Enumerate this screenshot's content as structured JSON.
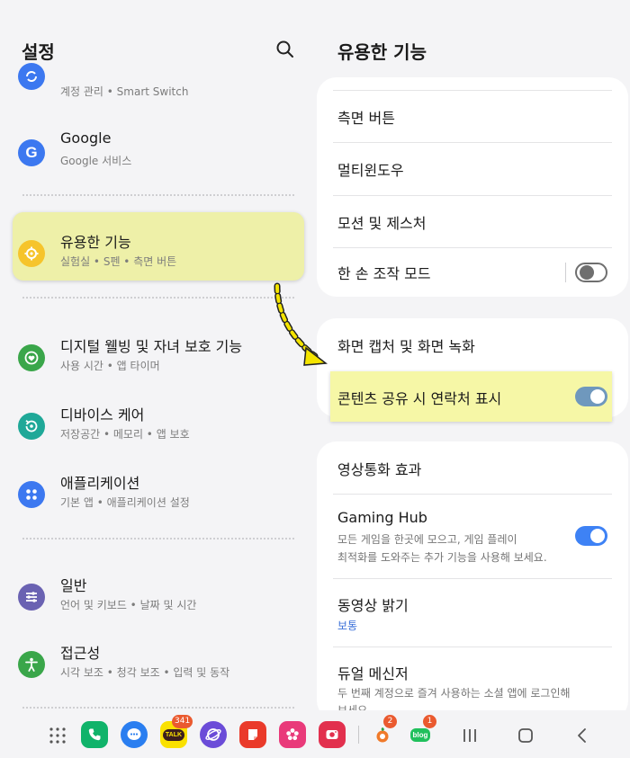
{
  "left": {
    "title": "설정",
    "rows": [
      {
        "title": "",
        "subtitle": "계정 관리 • Smart Switch",
        "icon": "sync-icon",
        "color": "#3c78f0"
      },
      {
        "title": "Google",
        "subtitle": "Google 서비스",
        "icon": "google-icon",
        "color": "#3c78f0"
      },
      {
        "title": "유용한 기능",
        "subtitle": "실험실 • S펜 • 측면 버튼",
        "icon": "gear-plus-icon",
        "color": "#f6c42c"
      },
      {
        "title": "디지털 웰빙 및 자녀 보호 기능",
        "subtitle": "사용 시간 • 앱 타이머",
        "icon": "heart-circle-icon",
        "color": "#3aa64a"
      },
      {
        "title": "디바이스 케어",
        "subtitle": "저장공간 • 메모리 • 앱 보호",
        "icon": "refresh-circle-icon",
        "color": "#1fa898"
      },
      {
        "title": "애플리케이션",
        "subtitle": "기본 앱 • 애플리케이션 설정",
        "icon": "apps-grid-icon",
        "color": "#3c78f0"
      },
      {
        "title": "일반",
        "subtitle": "언어 및 키보드 • 날짜 및 시간",
        "icon": "sliders-icon",
        "color": "#6a62b2"
      },
      {
        "title": "접근성",
        "subtitle": "시각 보조 • 청각 보조 • 입력 및 동작",
        "icon": "accessibility-icon",
        "color": "#3aa64a"
      }
    ]
  },
  "right": {
    "title": "유용한 기능",
    "card1": [
      "측면 버튼",
      "멀티윈도우",
      "모션 및 제스처",
      "한 손 조작 모드"
    ],
    "card2": [
      "화면 캡처 및 화면 녹화",
      "콘텐츠 공유 시 연락처 표시"
    ],
    "card3": {
      "video_call": "영상통화 효과",
      "gaming_hub": {
        "title": "Gaming Hub",
        "line1": "모든 게임을 한곳에 모으고, 게임 플레이",
        "line2": "최적화를 도와주는 추가 기능을 사용해 보세요."
      },
      "video_brightness": {
        "title": "동영상 밝기",
        "value": "보통"
      },
      "dual_messenger": {
        "title": "듀얼 메신저",
        "line1": "두 번째 계정으로 즐겨 사용하는 소셜 앱에 로그인해",
        "line2": "보세요."
      }
    },
    "toggles": {
      "one_hand": false,
      "contact_share": true,
      "gaming_hub": true
    }
  },
  "nav": {
    "kakao_badge": "341",
    "app8_badge": "2",
    "blog_badge": "1",
    "kakao_text": "TALK",
    "blog_text": "blog"
  },
  "colors": {
    "highlight": "#eef0a8",
    "arrow": "#f4e400",
    "accent": "#3e82f5"
  }
}
